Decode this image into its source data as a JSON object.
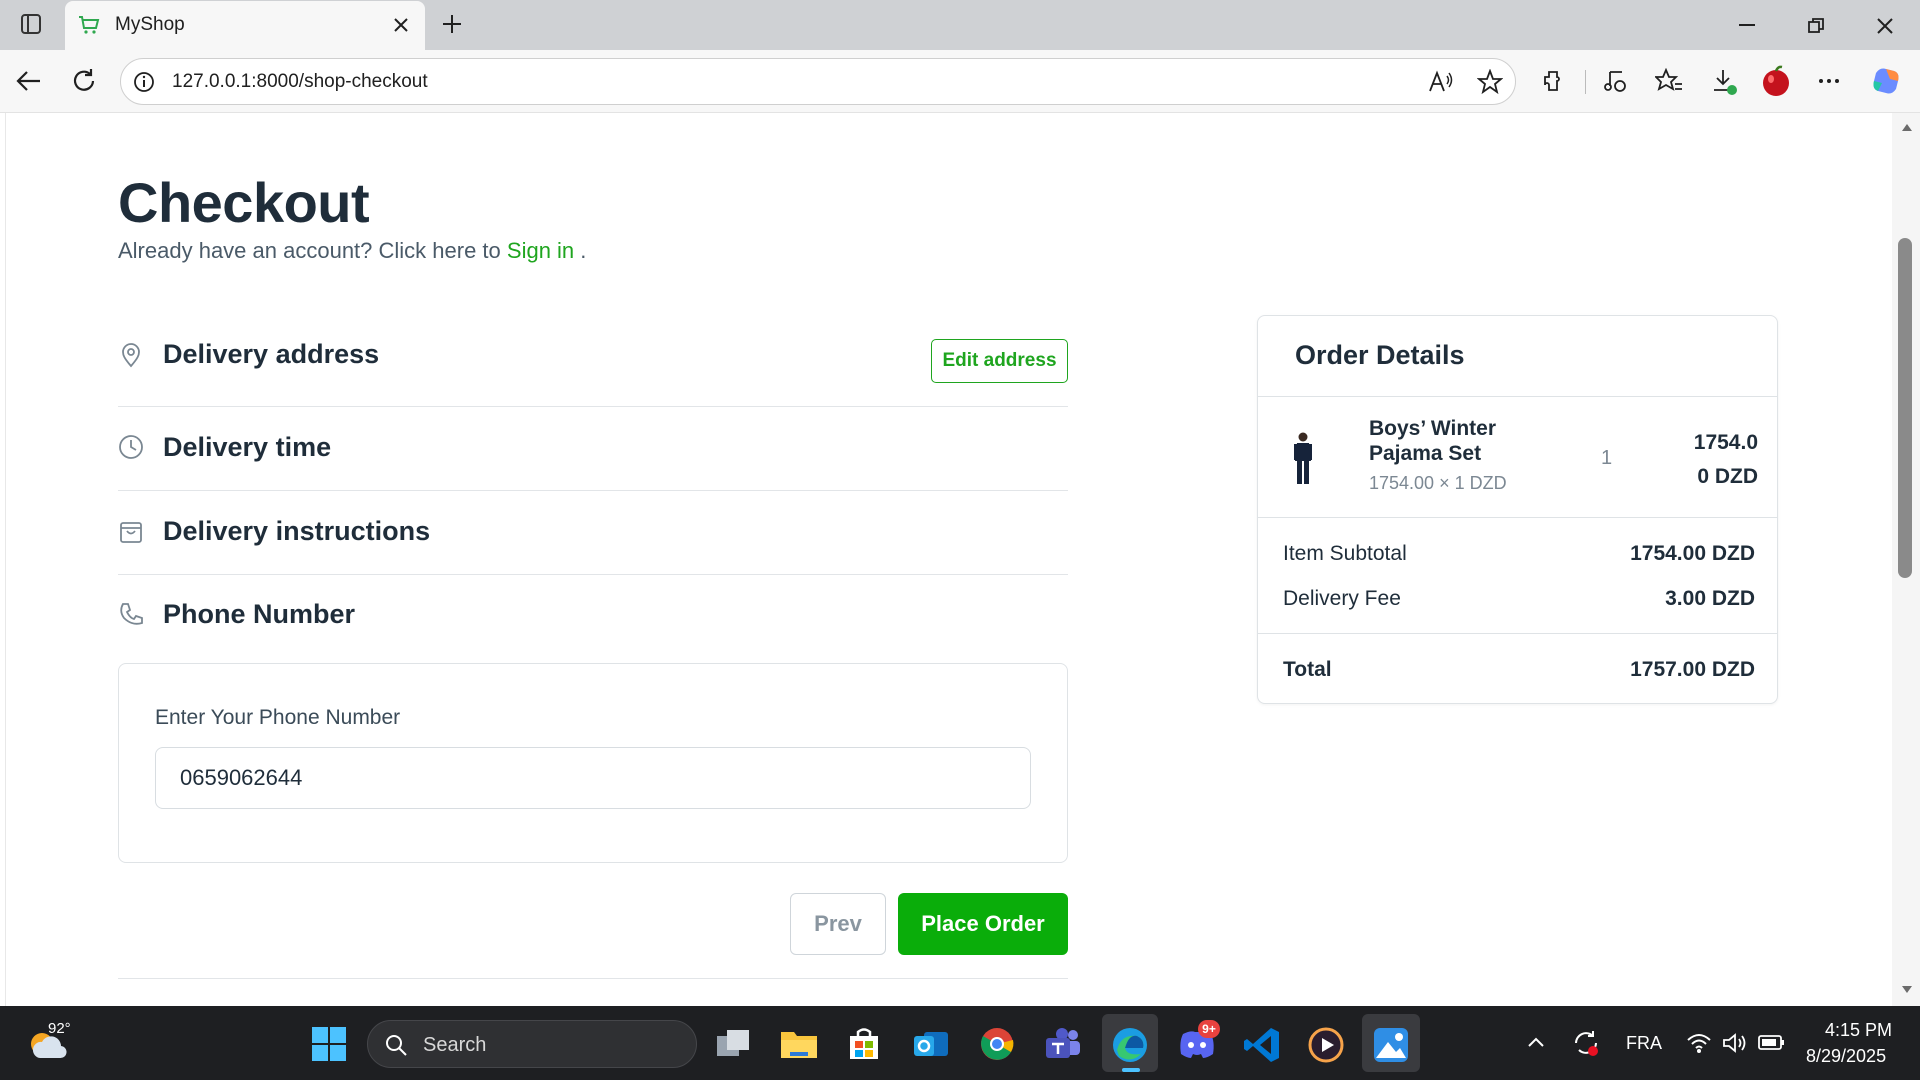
{
  "browser": {
    "tab_title": "MyShop",
    "url": "127.0.0.1:8000/shop-checkout"
  },
  "checkout": {
    "title": "Checkout",
    "account_prompt": "Already have an account? Click here to ",
    "sign_in_link": "Sign in",
    "account_prompt_end": " .",
    "sections": {
      "delivery_address": "Delivery address",
      "edit_address_button": "Edit address",
      "delivery_time": "Delivery time",
      "delivery_instructions": "Delivery instructions",
      "phone_number": "Phone Number"
    },
    "phone": {
      "label": "Enter Your Phone Number",
      "value": "0659062644"
    },
    "buttons": {
      "prev": "Prev",
      "place_order": "Place Order"
    }
  },
  "order_details": {
    "title": "Order Details",
    "item": {
      "name": "Boys’ Winter Pajama Set",
      "unit_line": "1754.00 × 1 DZD",
      "quantity": "1",
      "price_line1": "1754.0",
      "price_line2": "0 DZD"
    },
    "subtotal_label": "Item Subtotal",
    "subtotal_value": "1754.00 DZD",
    "delivery_fee_label": "Delivery Fee",
    "delivery_fee_value": "3.00 DZD",
    "total_label": "Total",
    "total_value": "1757.00 DZD"
  },
  "taskbar": {
    "weather_temp": "92°",
    "search_placeholder": "Search",
    "discord_badge": "9+",
    "language": "FRA",
    "time": "4:15 PM",
    "date": "8/29/2025"
  },
  "colors": {
    "accent_green": "#0aad0a",
    "link_green": "#1fa51f",
    "heading": "#1f2d3a"
  }
}
